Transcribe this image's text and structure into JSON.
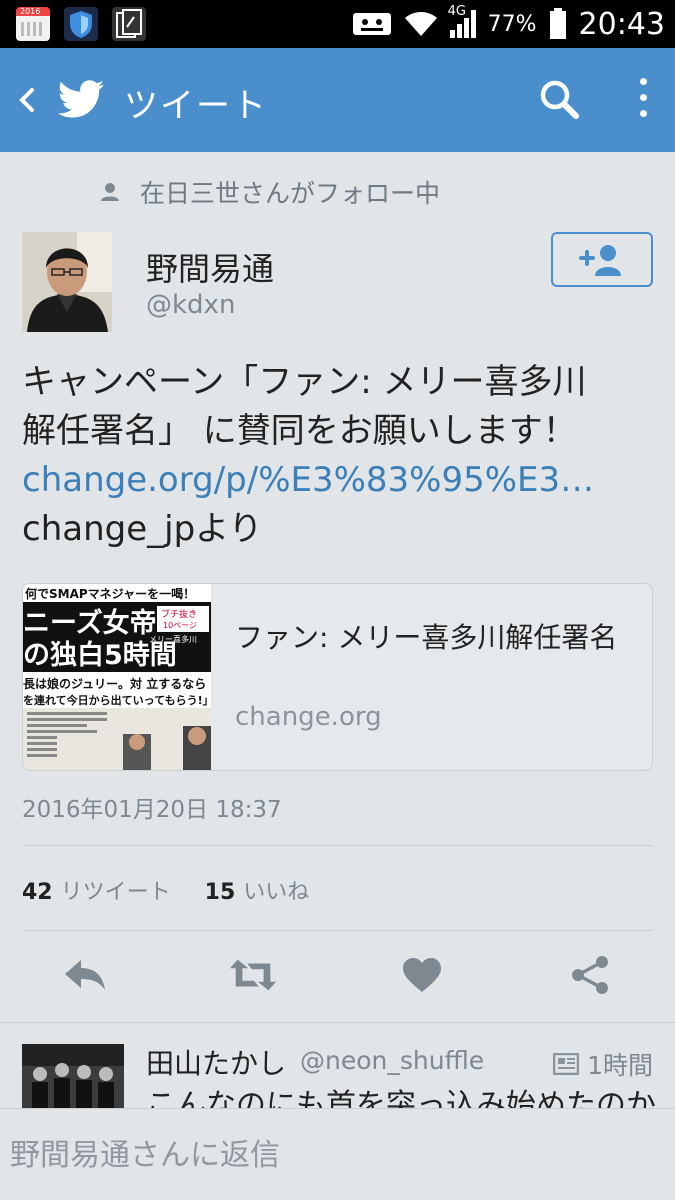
{
  "status_bar": {
    "calendar_label": "2016",
    "battery": "77%",
    "network": "4G",
    "time": "20:43"
  },
  "app_bar": {
    "title": "ツイート"
  },
  "tweet": {
    "social_context": "在日三世さんがフォロー中",
    "author_name": "野間易通",
    "author_handle": "@kdxn",
    "text_line1": "キャンペーン「ファン: メリー喜多川",
    "text_line2": "解任署名」 に賛同をお願いします！",
    "link": "change.org/p/%E3%83%95%E3…",
    "text_line4": "change_jpより",
    "card": {
      "title": "ファン: メリー喜多川解任署名",
      "domain": "change.org",
      "image_text": [
        "何でSMAPマネジャーを一喝！",
        "ニーズ女帝",
        "の独白5時間",
        "長は娘のジュリー。対 立するなら",
        "を連れて今日から出ていってもらう!」",
        "ブチ抜き",
        "10ページ",
        "メリー喜多川"
      ]
    },
    "timestamp": "2016年01月20日 18:37",
    "retweet_count": "42",
    "retweet_label": "リツイート",
    "like_count": "15",
    "like_label": "いいね"
  },
  "reply": {
    "name": "田山たかし",
    "handle": "@neon_shuffle",
    "time": "1時間",
    "text": "こんなのにも首を突っ込み始めたのか"
  },
  "composer": {
    "placeholder": "野間易通さんに返信"
  },
  "colors": {
    "accent": "#4a8fcc",
    "link": "#3a7fb8",
    "background": "#e1e5e8"
  }
}
